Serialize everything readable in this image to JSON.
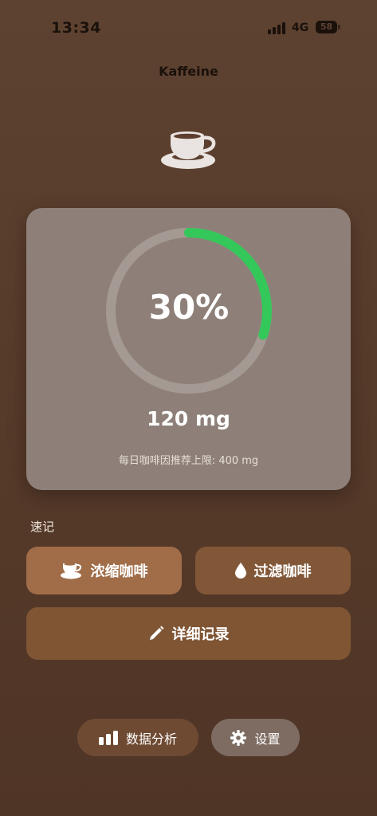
{
  "status_bar": {
    "time": "13:34",
    "network": "4G",
    "battery": "58"
  },
  "app": {
    "title": "Kaffeine"
  },
  "progress": {
    "percent_label": "30%",
    "percent_value": 0.3,
    "amount": "120 mg",
    "limit_text": "每日咖啡因推荐上限: 400 mg",
    "ring_color": "#34c759",
    "track_color": "#a59993"
  },
  "quick_log": {
    "label": "速记",
    "espresso": "浓缩咖啡",
    "filter": "过滤咖啡",
    "detail": "详细记录"
  },
  "nav": {
    "analytics": "数据分析",
    "settings": "设置"
  },
  "icons": {
    "cup": "coffee-cup-icon",
    "drop": "water-drop-icon",
    "pencil": "pencil-icon",
    "chart": "bar-chart-icon",
    "gear": "gear-icon"
  }
}
